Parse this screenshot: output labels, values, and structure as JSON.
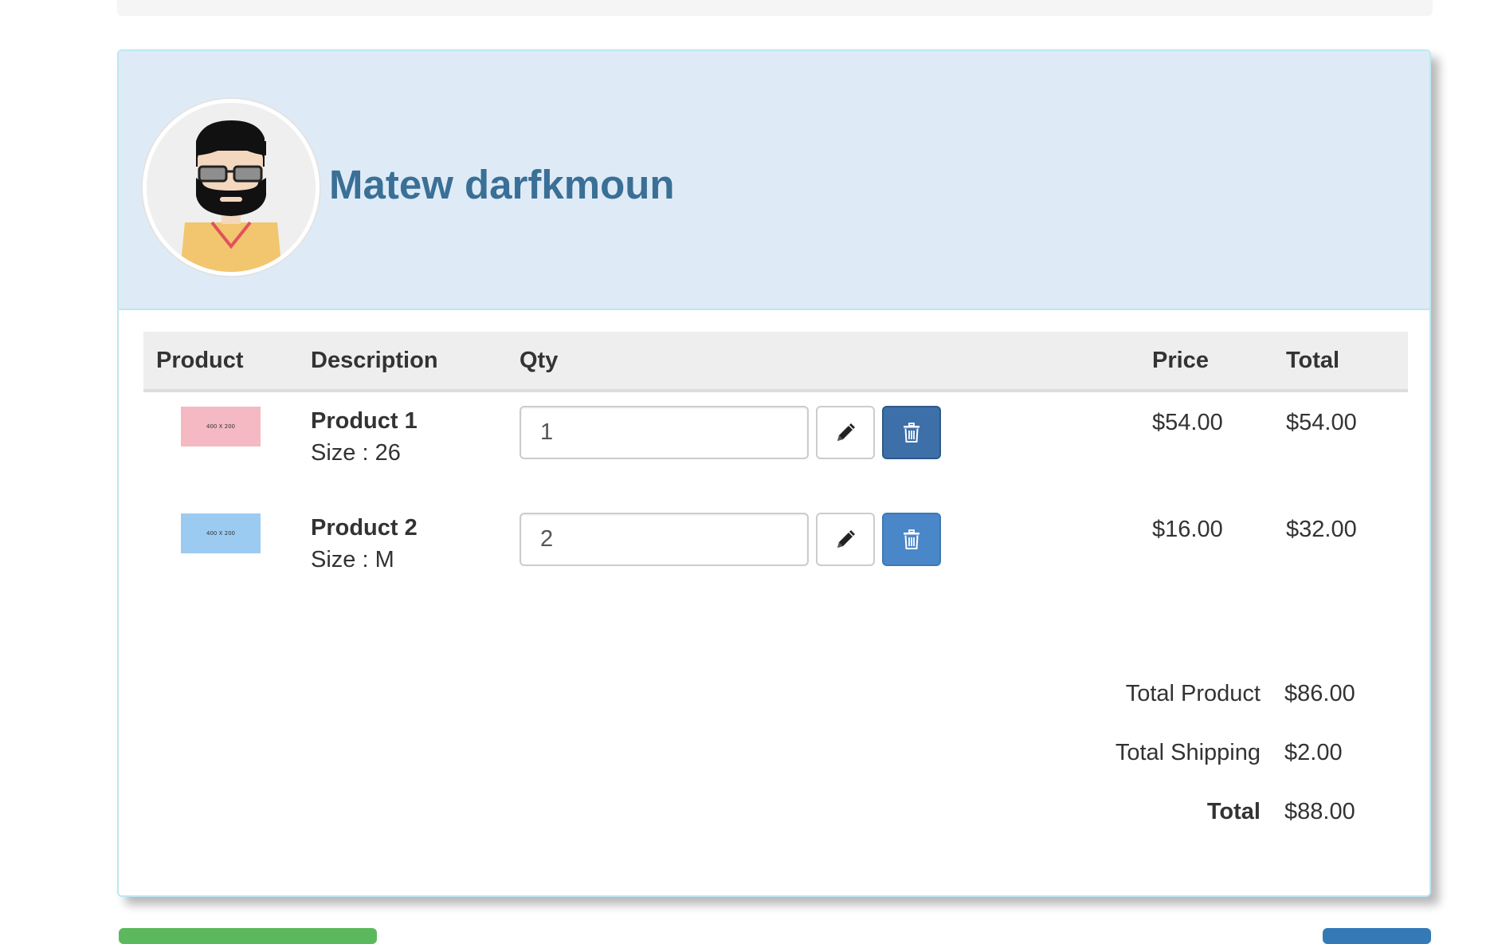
{
  "customer": {
    "name": "Matew darfkmoun"
  },
  "table": {
    "headers": {
      "product": "Product",
      "description": "Description",
      "qty": "Qty",
      "price": "Price",
      "total": "Total"
    },
    "rows": [
      {
        "thumb_text": "400 X 200",
        "thumb_color": "#f4b9c2",
        "name": "Product 1",
        "size": "Size : 26",
        "qty": "1",
        "price": "$54.00",
        "total": "$54.00",
        "delete_color": "#3d6fa8"
      },
      {
        "thumb_text": "400 X 200",
        "thumb_color": "#9ccbf2",
        "name": "Product 2",
        "size": "Size : M",
        "qty": "2",
        "price": "$16.00",
        "total": "$32.00",
        "delete_color": "#4a87c8"
      }
    ]
  },
  "summary": {
    "total_product_label": "Total Product",
    "total_product_value": "$86.00",
    "total_shipping_label": "Total Shipping",
    "total_shipping_value": "$2.00",
    "total_label": "Total",
    "total_value": "$88.00"
  },
  "colors": {
    "heading_bg": "#deebf7",
    "name_color": "#3a6f96",
    "panel_border": "#bce8f1"
  },
  "icons": {
    "edit": "pencil-icon",
    "delete": "trash-icon"
  }
}
